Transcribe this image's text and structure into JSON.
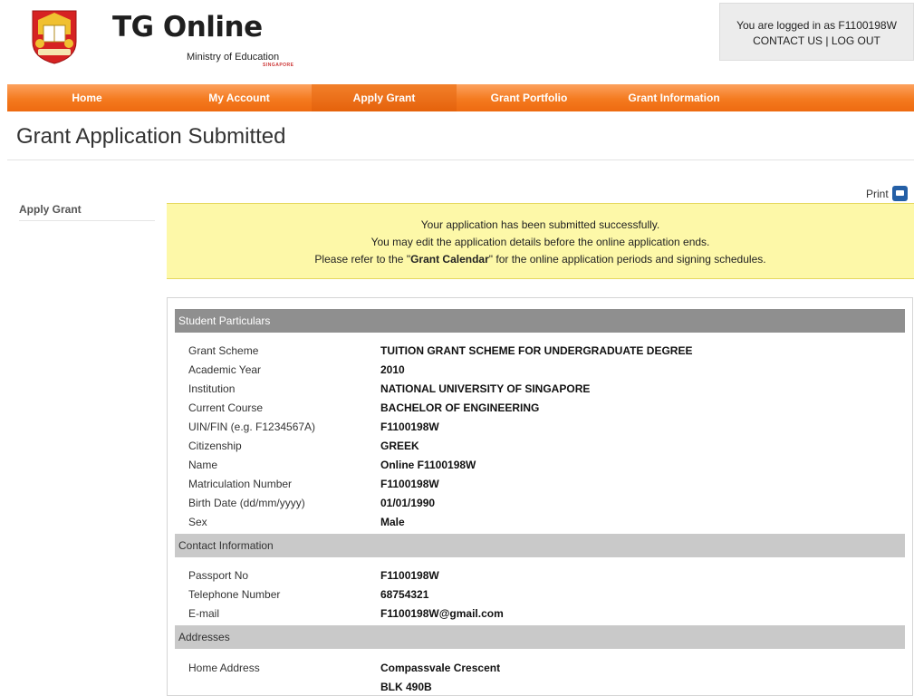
{
  "header": {
    "app_name": "TG Online",
    "ministry": "Ministry of Education",
    "crest_text": "SINGAPORE",
    "login_text": "You are logged in as F1100198W",
    "contact_label": "CONTACT US",
    "separator": "|",
    "logout_label": "LOG OUT"
  },
  "nav": {
    "items": [
      "Home",
      "My Account",
      "Apply Grant",
      "Grant Portfolio",
      "Grant Information"
    ],
    "active_index": 2,
    "colors": {
      "bar": "#f47a1f",
      "active": "#e5620b"
    }
  },
  "page": {
    "title": "Grant Application Submitted",
    "sidebar_item": "Apply Grant",
    "print_label": "Print"
  },
  "notice": {
    "line1": "Your application has been submitted successfully.",
    "line2": "You may edit the application details before the online application ends.",
    "line3_prefix": "Please refer to the \"",
    "line3_link": "Grant Calendar",
    "line3_suffix": "\" for the online application periods and signing schedules."
  },
  "sections": {
    "student": {
      "title": "Student Particulars",
      "rows": [
        {
          "label": "Grant Scheme",
          "value": "TUITION GRANT SCHEME FOR UNDERGRADUATE DEGREE"
        },
        {
          "label": "Academic Year",
          "value": "2010"
        },
        {
          "label": "Institution",
          "value": "NATIONAL UNIVERSITY OF SINGAPORE"
        },
        {
          "label": "Current Course",
          "value": "BACHELOR OF ENGINEERING"
        },
        {
          "label": "UIN/FIN (e.g. F1234567A)",
          "value": "F1100198W"
        },
        {
          "label": "Citizenship",
          "value": "GREEK"
        },
        {
          "label": "Name",
          "value": "Online F1100198W"
        },
        {
          "label": "Matriculation Number",
          "value": "F1100198W"
        },
        {
          "label": "Birth Date (dd/mm/yyyy)",
          "value": "01/01/1990"
        },
        {
          "label": "Sex",
          "value": "Male"
        }
      ]
    },
    "contact": {
      "title": "Contact Information",
      "rows": [
        {
          "label": "Passport No",
          "value": "F1100198W"
        },
        {
          "label": "Telephone Number",
          "value": "68754321"
        },
        {
          "label": "E-mail",
          "value": "F1100198W@gmail.com"
        }
      ]
    },
    "addresses": {
      "title": "Addresses",
      "rows": [
        {
          "label": "Home Address",
          "value": "Compassvale Crescent"
        },
        {
          "label": "",
          "value": "BLK 490B"
        }
      ]
    }
  }
}
